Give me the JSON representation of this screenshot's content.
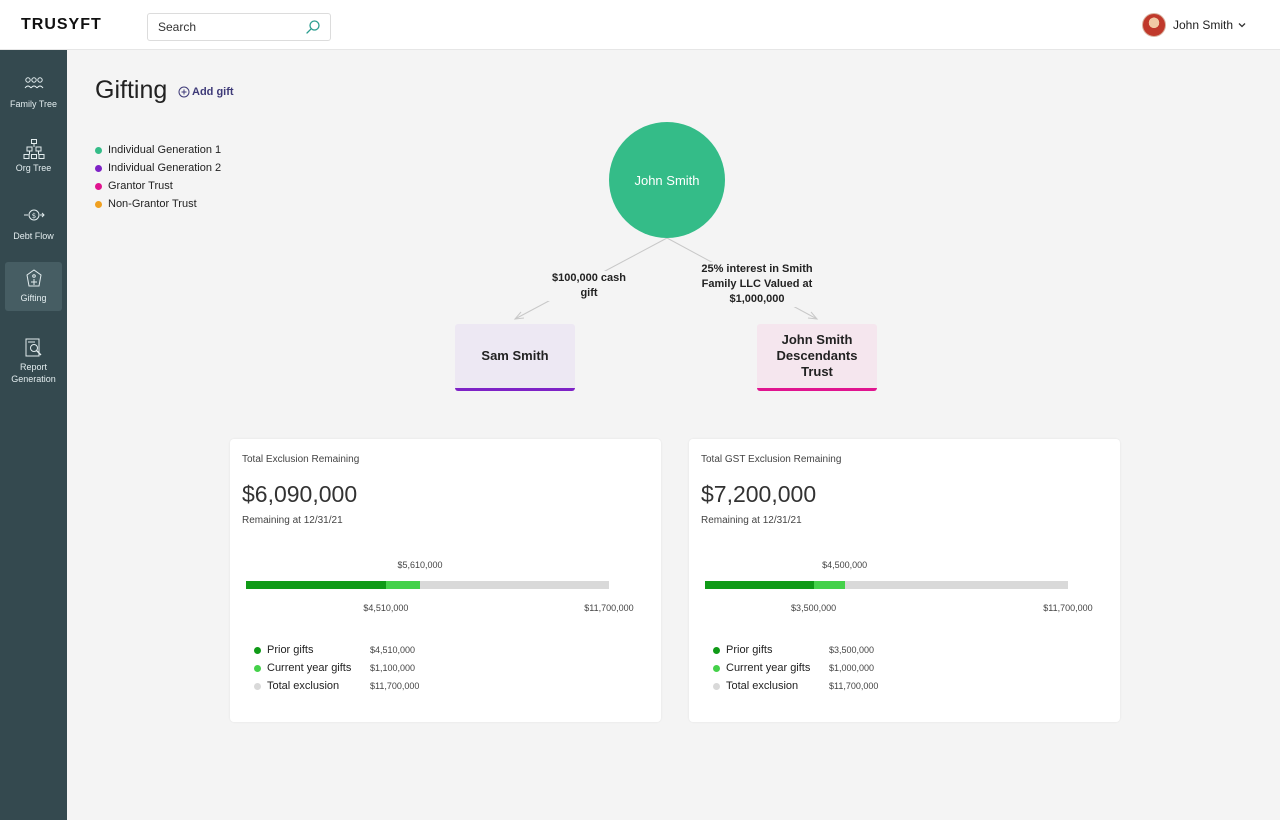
{
  "header": {
    "logo": "TRUSYFT",
    "search_placeholder": "Search",
    "user_name": "John Smith"
  },
  "sidebar": {
    "items": [
      {
        "label": "Family Tree",
        "icon": "family-tree-icon",
        "active": false
      },
      {
        "label": "Org Tree",
        "icon": "org-tree-icon",
        "active": false
      },
      {
        "label": "Debt Flow",
        "icon": "debt-flow-icon",
        "active": false
      },
      {
        "label": "Gifting",
        "icon": "gifting-icon",
        "active": true
      },
      {
        "label": "Report Generation",
        "icon": "report-icon",
        "active": false
      }
    ]
  },
  "page": {
    "title": "Gifting",
    "add_gift_label": "Add gift"
  },
  "legend": [
    {
      "label": "Individual Generation 1",
      "color": "#34bc88"
    },
    {
      "label": "Individual Generation 2",
      "color": "#7e22c6"
    },
    {
      "label": "Grantor Trust",
      "color": "#e0148f"
    },
    {
      "label": "Non-Grantor Trust",
      "color": "#f0a020"
    }
  ],
  "diagram": {
    "root": {
      "label": "John Smith",
      "color": "#34bc88"
    },
    "edges": [
      {
        "label": "$100,000 cash gift"
      },
      {
        "label": "25% interest in Smith Family LLC Valued at $1,000,000"
      }
    ],
    "children": [
      {
        "label": "Sam Smith",
        "color": "#7e22c6"
      },
      {
        "label": "John Smith Descendants Trust",
        "color": "#e0148f"
      }
    ]
  },
  "colors": {
    "prior": "#0f9a17",
    "current": "#44d14a",
    "total": "#d9d9d9"
  },
  "cards": [
    {
      "title": "Total Exclusion Remaining",
      "amount": "$6,090,000",
      "subtitle": "Remaining at 12/31/21",
      "top_label": "$5,610,000",
      "prior_label": "$4,510,000",
      "total_label": "$11,700,000",
      "prior_value": 4510000,
      "current_value": 1100000,
      "total_value": 11700000,
      "legend": [
        {
          "label": "Prior gifts",
          "value": "$4,510,000"
        },
        {
          "label": "Current year gifts",
          "value": "$1,100,000"
        },
        {
          "label": "Total exclusion",
          "value": "$11,700,000"
        }
      ]
    },
    {
      "title": "Total GST Exclusion Remaining",
      "amount": "$7,200,000",
      "subtitle": "Remaining at 12/31/21",
      "top_label": "$4,500,000",
      "prior_label": "$3,500,000",
      "total_label": "$11,700,000",
      "prior_value": 3500000,
      "current_value": 1000000,
      "total_value": 11700000,
      "legend": [
        {
          "label": "Prior gifts",
          "value": "$3,500,000"
        },
        {
          "label": "Current year gifts",
          "value": "$1,000,000"
        },
        {
          "label": "Total exclusion",
          "value": "$11,700,000"
        }
      ]
    }
  ]
}
